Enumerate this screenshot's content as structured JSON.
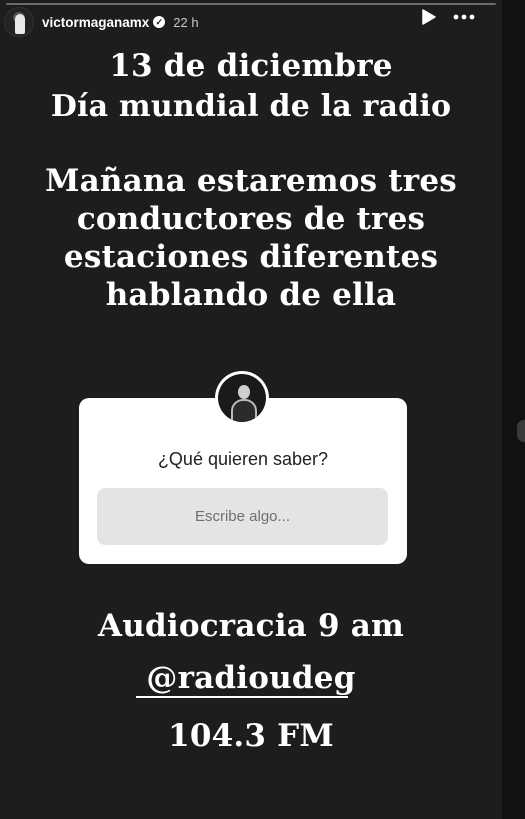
{
  "header": {
    "username": "victormaganamx",
    "time": "22 h",
    "verified_icon": "verified-badge-icon",
    "play_icon": "play-icon",
    "more_icon": "more-horizontal-icon",
    "progress": 0.0
  },
  "story": {
    "date_line": "13 de diciembre",
    "day_line": "Día mundial de la radio",
    "announcement": [
      "Mañana estaremos tres",
      "conductores de tres",
      "estaciones diferentes",
      "hablando de ella"
    ],
    "program": "Audiocracia 9 am",
    "handle": "@radioudeg",
    "frequency": "104.3 FM"
  },
  "question_sticker": {
    "question": "¿Qué quieren saber?",
    "placeholder": "Escribe algo..."
  },
  "colors": {
    "background": "#1d1d1d",
    "text": "#ffffff",
    "sticker_bg": "#ffffff",
    "field_bg": "#e4e4e4"
  }
}
